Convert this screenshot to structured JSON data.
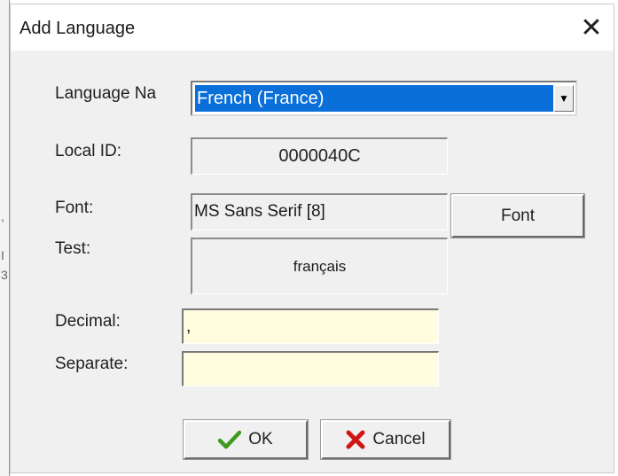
{
  "window": {
    "title": "Add Language",
    "close_glyph": "✕"
  },
  "left_edge_marks": [
    ",",
    "I",
    "3"
  ],
  "form": {
    "language_label": "Language Na",
    "language_value": "French (France)",
    "dropdown_arrow": "▼",
    "local_id_label": "Local ID:",
    "local_id_value": "0000040C",
    "font_label": "Font:",
    "font_value": "MS Sans Serif [8]",
    "font_button_label": "Font",
    "test_label": "Test:",
    "test_value": "français",
    "decimal_label": "Decimal:",
    "decimal_value": ",",
    "separate_label": "Separate:",
    "separate_value": ""
  },
  "buttons": {
    "ok_label": "OK",
    "ok_icon": "check-icon",
    "cancel_label": "Cancel",
    "cancel_icon": "x-mark-icon"
  },
  "colors": {
    "selection": "#0a6fd8",
    "input_yellow": "#fffce0",
    "ok_icon": "#3f9a1e",
    "cancel_icon": "#d01515"
  }
}
